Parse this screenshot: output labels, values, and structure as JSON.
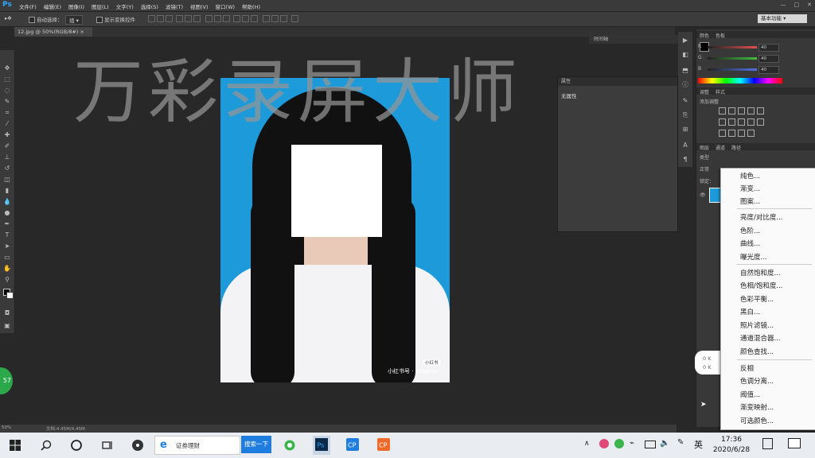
{
  "menubar": {
    "app_logo": "Ps",
    "items": [
      "文件(F)",
      "编辑(E)",
      "图像(I)",
      "图层(L)",
      "文字(Y)",
      "选择(S)",
      "滤镜(T)",
      "视图(V)",
      "窗口(W)",
      "帮助(H)"
    ],
    "window_buttons": [
      "—",
      "□",
      "✕"
    ]
  },
  "options": {
    "auto_select_label": "自动选择：",
    "auto_select_value": "组",
    "show_transform_label": "显示变换控件",
    "preset_label": "基本功能"
  },
  "document": {
    "tab_label": "12.jpg @ 50%(RGB/8#)"
  },
  "canvas": {
    "watermark_text": "万彩录屏大师",
    "photo_badge": "小红书",
    "photo_watermark": "小红书号 · Kiligovo"
  },
  "properties_panel": {
    "title": "属性",
    "subtitle": "无属性",
    "top_label": "时间轴"
  },
  "right_panel": {
    "color_tabs": [
      "颜色",
      "色板"
    ],
    "channels": [
      {
        "label": "R",
        "value": "40",
        "color": "#e05050"
      },
      {
        "label": "G",
        "value": "40",
        "color": "#40c040"
      },
      {
        "label": "B",
        "value": "40",
        "color": "#5070e0"
      }
    ],
    "adjust_tabs": [
      "调整",
      "样式"
    ],
    "adjust_title": "添加调整",
    "layer_tabs": [
      "图层",
      "通道",
      "路径"
    ],
    "layer_kind": "类型",
    "layer_mode": "正常",
    "lock_label": "锁定："
  },
  "dropdown": {
    "group1": [
      "纯色...",
      "渐变...",
      "图案..."
    ],
    "group2": [
      "亮度/对比度...",
      "色阶...",
      "曲线...",
      "曝光度..."
    ],
    "group3": [
      "自然饱和度...",
      "色相/饱和度...",
      "色彩平衡...",
      "黑白...",
      "照片滤镜...",
      "通道混合器...",
      "颜色查找..."
    ],
    "group4": [
      "反相",
      "色调分离...",
      "阈值...",
      "渐变映射...",
      "可选颜色..."
    ]
  },
  "notifications": {
    "items": [
      "0 K",
      "0 K"
    ],
    "green_badge": "57"
  },
  "status": {
    "zoom": "50%",
    "doc_info": "文档:4.45M/4.45M"
  },
  "taskbar": {
    "search_placeholder": "证券理财",
    "search_button": "搜索一下",
    "ime": "英",
    "time": "17:36",
    "date": "2020/6/28"
  },
  "colors": {
    "accent": "#31a8ff",
    "taskbar_search_btn": "#1f7de0",
    "photo_bg": "#1c9ad9"
  }
}
